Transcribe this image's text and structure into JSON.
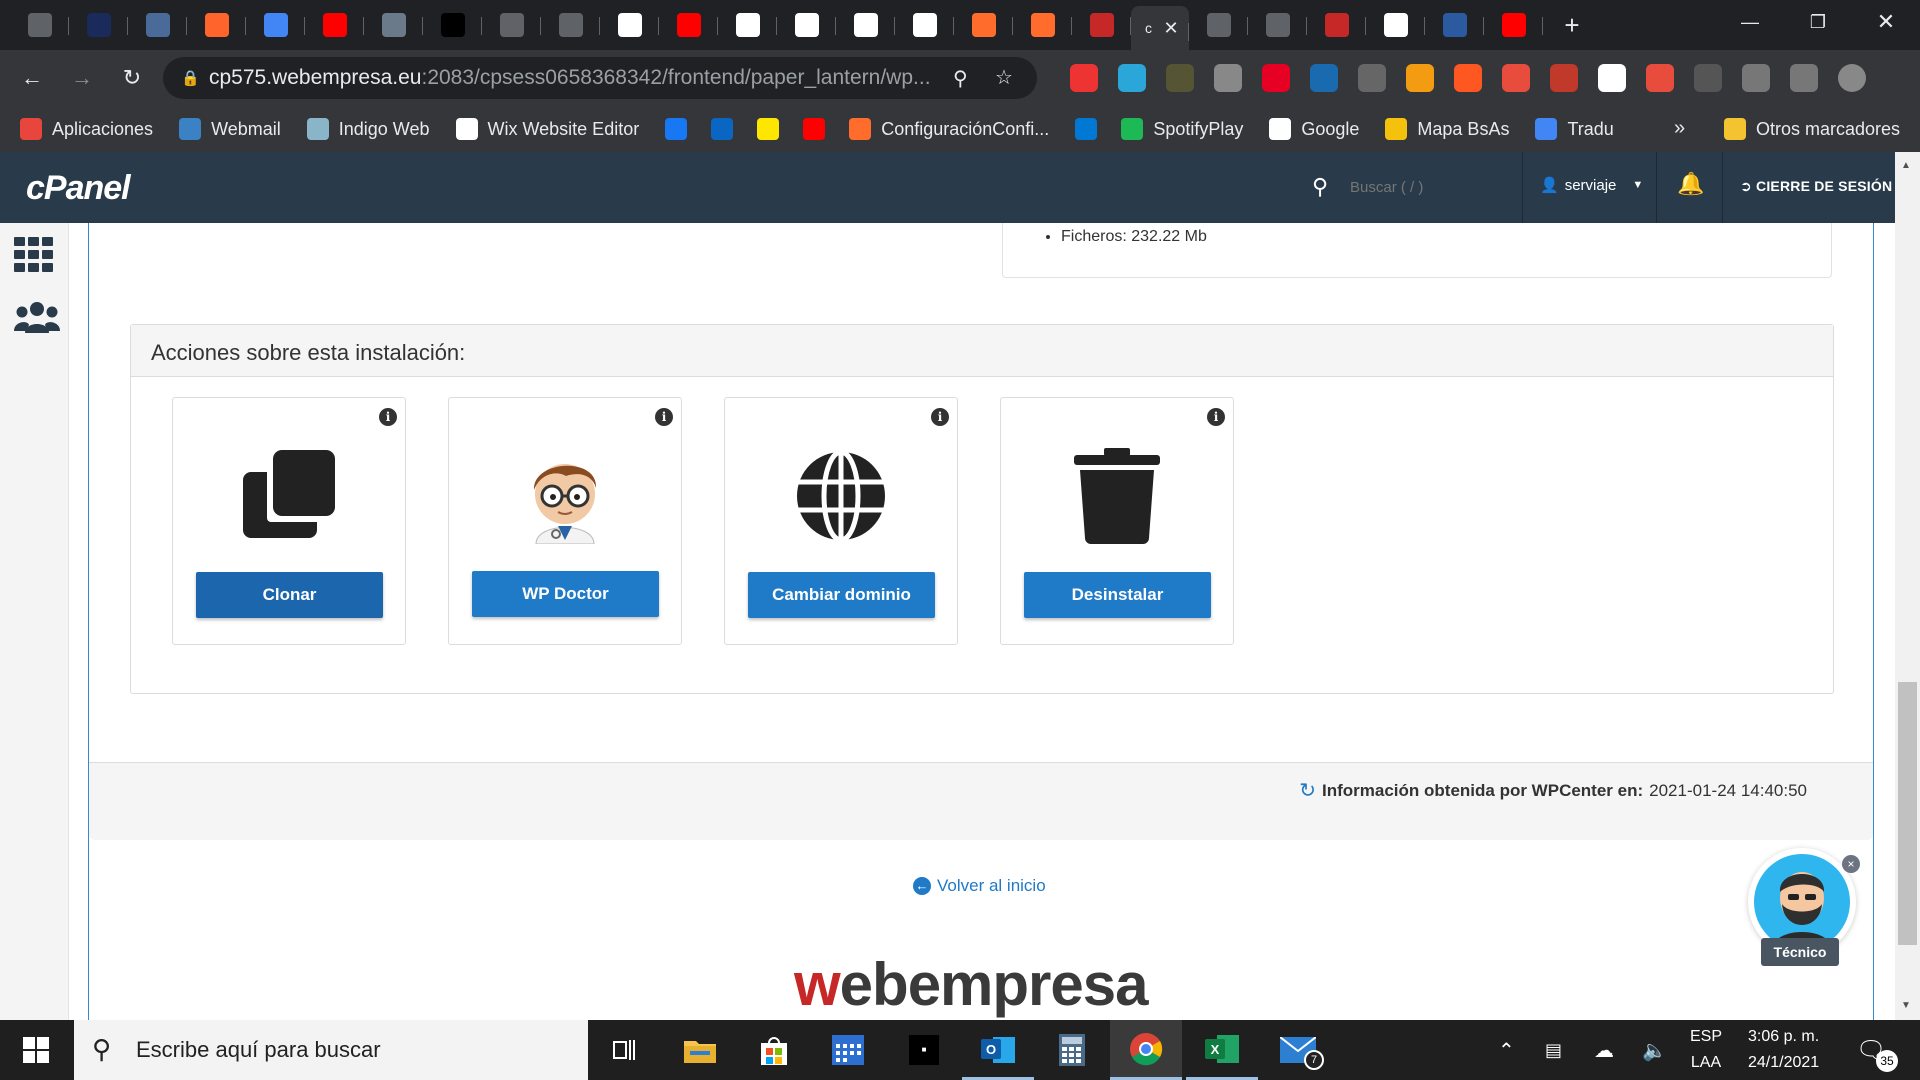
{
  "browser": {
    "tabs": [
      {
        "icon": "page-icon",
        "color": "#5f6368"
      },
      {
        "icon": "dc-icon",
        "color": "#1a2a5a"
      },
      {
        "icon": "compass-icon",
        "color": "#4a6a9a"
      },
      {
        "icon": "semrush-icon",
        "color": "#ff642d"
      },
      {
        "icon": "docs-icon",
        "color": "#4285f4"
      },
      {
        "icon": "youtube-icon",
        "color": "#ff0000"
      },
      {
        "icon": "globe-icon",
        "color": "#6b7a8a"
      },
      {
        "icon": "face-icon",
        "color": "#000000"
      },
      {
        "icon": "page-icon",
        "color": "#5f6368"
      },
      {
        "icon": "page-icon",
        "color": "#5f6368"
      },
      {
        "icon": "google-icon",
        "color": "#ffffff"
      },
      {
        "icon": "youtube-icon",
        "color": "#ff0000"
      },
      {
        "icon": "webempresa-icon",
        "color": "#ffffff"
      },
      {
        "icon": "webempresa-icon",
        "color": "#ffffff"
      },
      {
        "icon": "webempresa-icon",
        "color": "#ffffff"
      },
      {
        "icon": "webempresa-icon",
        "color": "#ffffff"
      },
      {
        "icon": "cpanel-icon",
        "color": "#ff6c2c"
      },
      {
        "icon": "cpanel-icon",
        "color": "#ff6c2c"
      },
      {
        "icon": "webempresa-circle-icon",
        "color": "#c62828"
      }
    ],
    "active_tab_label": "c",
    "tabs_after": [
      {
        "icon": "page-icon",
        "color": "#5f6368"
      },
      {
        "icon": "page-icon",
        "color": "#5f6368"
      },
      {
        "icon": "webempresa-circle-icon",
        "color": "#c62828"
      },
      {
        "icon": "webempresa-icon",
        "color": "#ffffff"
      },
      {
        "icon": "w-blue-icon",
        "color": "#2c5aa0"
      },
      {
        "icon": "youtube-icon",
        "color": "#ff0000"
      }
    ],
    "url_host": "cp575.webempresa.eu",
    "url_path": ":2083/cpsess0658368342/frontend/paper_lantern/wp...",
    "bookmarks": [
      {
        "label": "Aplicaciones",
        "icon": "apps-grid-icon",
        "color": "#e8453c"
      },
      {
        "label": "Webmail",
        "icon": "webmail-icon",
        "color": "#3b82c4"
      },
      {
        "label": "Indigo Web",
        "icon": "indigo-icon",
        "color": "#8ab4c8"
      },
      {
        "label": "Wix Website Editor",
        "icon": "wix-icon",
        "color": "#ffffff"
      },
      {
        "label": "",
        "icon": "facebook-icon",
        "color": "#1877f2"
      },
      {
        "label": "",
        "icon": "linkedin-icon",
        "color": "#0a66c2"
      },
      {
        "label": "",
        "icon": "mercadolibre-icon",
        "color": "#ffe600"
      },
      {
        "label": "",
        "icon": "youtube-icon",
        "color": "#ff0000"
      },
      {
        "label": "ConfiguraciónConfi...",
        "icon": "cpanel-icon",
        "color": "#ff6c2c"
      },
      {
        "label": "",
        "icon": "outlook-icon",
        "color": "#0078d4"
      },
      {
        "label": "SpotifyPlay",
        "icon": "spotify-icon",
        "color": "#1db954"
      },
      {
        "label": "Google",
        "icon": "google-icon",
        "color": "#ffffff"
      },
      {
        "label": "Mapa BsAs",
        "icon": "map-pin-icon",
        "color": "#f4c20d"
      },
      {
        "label": "Tradu",
        "icon": "translate-icon",
        "color": "#4285f4"
      }
    ],
    "overflow": "»",
    "other_bookmarks": "Otros marcadores"
  },
  "cpanel": {
    "logo": "cPanel",
    "search_placeholder": "Buscar ( / )",
    "user": "serviaje",
    "logout": "CIERRE DE SESIÓN"
  },
  "installation": {
    "files_item": "Ficheros: 232.22 Mb",
    "actions_title": "Acciones sobre esta instalación:",
    "actions": [
      {
        "label": "Clonar",
        "icon": "clone-icon"
      },
      {
        "label": "WP Doctor",
        "icon": "doctor-avatar-icon"
      },
      {
        "label": "Cambiar dominio",
        "icon": "globe-icon"
      },
      {
        "label": "Desinstalar",
        "icon": "trash-icon"
      }
    ],
    "info_glyph": "i",
    "footer_label": "Información obtenida por WPCenter en:",
    "footer_date": "2021-01-24 14:40:50",
    "back_link": "Volver al inicio",
    "brand_w": "w",
    "brand_rest": "ebempresa"
  },
  "chatbot": {
    "label": "Técnico",
    "close": "×"
  },
  "taskbar": {
    "search_placeholder": "Escribe aquí para buscar",
    "lang_top": "ESP",
    "lang_bottom": "LAA",
    "time": "3:06 p. m.",
    "date": "24/1/2021",
    "mail_badge": "7",
    "notif_count": "35"
  }
}
